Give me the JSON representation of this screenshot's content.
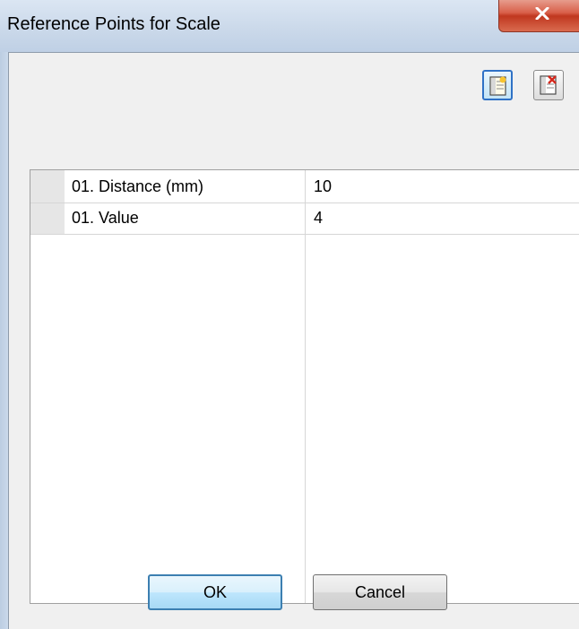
{
  "window": {
    "title": "Reference Points for Scale",
    "close_icon": "close-icon"
  },
  "toolbar": {
    "buttons": [
      {
        "icon": "add-row-icon",
        "active": true
      },
      {
        "icon": "delete-row-icon",
        "active": false
      }
    ]
  },
  "grid": {
    "rows": [
      {
        "name": "01. Distance (mm)",
        "value": "10"
      },
      {
        "name": "01. Value",
        "value": "4"
      }
    ]
  },
  "buttons": {
    "ok": "OK",
    "cancel": "Cancel"
  },
  "colors": {
    "title_bar": "#cbd9ea",
    "close_button": "#c0371f",
    "dialog_background": "#f0f0f0",
    "default_button_border": "#3c7fb1"
  }
}
